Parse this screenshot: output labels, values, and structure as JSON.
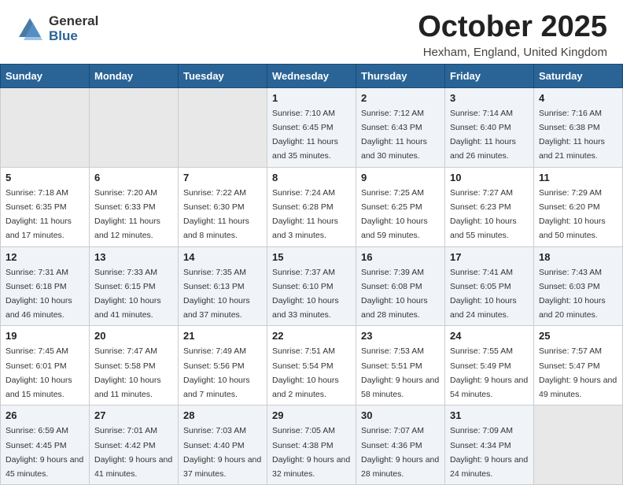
{
  "header": {
    "logo_general": "General",
    "logo_blue": "Blue",
    "month_title": "October 2025",
    "location": "Hexham, England, United Kingdom"
  },
  "days_of_week": [
    "Sunday",
    "Monday",
    "Tuesday",
    "Wednesday",
    "Thursday",
    "Friday",
    "Saturday"
  ],
  "weeks": [
    [
      {
        "day": "",
        "empty": true
      },
      {
        "day": "",
        "empty": true
      },
      {
        "day": "",
        "empty": true
      },
      {
        "day": "1",
        "sunrise": "7:10 AM",
        "sunset": "6:45 PM",
        "daylight": "11 hours and 35 minutes."
      },
      {
        "day": "2",
        "sunrise": "7:12 AM",
        "sunset": "6:43 PM",
        "daylight": "11 hours and 30 minutes."
      },
      {
        "day": "3",
        "sunrise": "7:14 AM",
        "sunset": "6:40 PM",
        "daylight": "11 hours and 26 minutes."
      },
      {
        "day": "4",
        "sunrise": "7:16 AM",
        "sunset": "6:38 PM",
        "daylight": "11 hours and 21 minutes."
      }
    ],
    [
      {
        "day": "5",
        "sunrise": "7:18 AM",
        "sunset": "6:35 PM",
        "daylight": "11 hours and 17 minutes."
      },
      {
        "day": "6",
        "sunrise": "7:20 AM",
        "sunset": "6:33 PM",
        "daylight": "11 hours and 12 minutes."
      },
      {
        "day": "7",
        "sunrise": "7:22 AM",
        "sunset": "6:30 PM",
        "daylight": "11 hours and 8 minutes."
      },
      {
        "day": "8",
        "sunrise": "7:24 AM",
        "sunset": "6:28 PM",
        "daylight": "11 hours and 3 minutes."
      },
      {
        "day": "9",
        "sunrise": "7:25 AM",
        "sunset": "6:25 PM",
        "daylight": "10 hours and 59 minutes."
      },
      {
        "day": "10",
        "sunrise": "7:27 AM",
        "sunset": "6:23 PM",
        "daylight": "10 hours and 55 minutes."
      },
      {
        "day": "11",
        "sunrise": "7:29 AM",
        "sunset": "6:20 PM",
        "daylight": "10 hours and 50 minutes."
      }
    ],
    [
      {
        "day": "12",
        "sunrise": "7:31 AM",
        "sunset": "6:18 PM",
        "daylight": "10 hours and 46 minutes."
      },
      {
        "day": "13",
        "sunrise": "7:33 AM",
        "sunset": "6:15 PM",
        "daylight": "10 hours and 41 minutes."
      },
      {
        "day": "14",
        "sunrise": "7:35 AM",
        "sunset": "6:13 PM",
        "daylight": "10 hours and 37 minutes."
      },
      {
        "day": "15",
        "sunrise": "7:37 AM",
        "sunset": "6:10 PM",
        "daylight": "10 hours and 33 minutes."
      },
      {
        "day": "16",
        "sunrise": "7:39 AM",
        "sunset": "6:08 PM",
        "daylight": "10 hours and 28 minutes."
      },
      {
        "day": "17",
        "sunrise": "7:41 AM",
        "sunset": "6:05 PM",
        "daylight": "10 hours and 24 minutes."
      },
      {
        "day": "18",
        "sunrise": "7:43 AM",
        "sunset": "6:03 PM",
        "daylight": "10 hours and 20 minutes."
      }
    ],
    [
      {
        "day": "19",
        "sunrise": "7:45 AM",
        "sunset": "6:01 PM",
        "daylight": "10 hours and 15 minutes."
      },
      {
        "day": "20",
        "sunrise": "7:47 AM",
        "sunset": "5:58 PM",
        "daylight": "10 hours and 11 minutes."
      },
      {
        "day": "21",
        "sunrise": "7:49 AM",
        "sunset": "5:56 PM",
        "daylight": "10 hours and 7 minutes."
      },
      {
        "day": "22",
        "sunrise": "7:51 AM",
        "sunset": "5:54 PM",
        "daylight": "10 hours and 2 minutes."
      },
      {
        "day": "23",
        "sunrise": "7:53 AM",
        "sunset": "5:51 PM",
        "daylight": "9 hours and 58 minutes."
      },
      {
        "day": "24",
        "sunrise": "7:55 AM",
        "sunset": "5:49 PM",
        "daylight": "9 hours and 54 minutes."
      },
      {
        "day": "25",
        "sunrise": "7:57 AM",
        "sunset": "5:47 PM",
        "daylight": "9 hours and 49 minutes."
      }
    ],
    [
      {
        "day": "26",
        "sunrise": "6:59 AM",
        "sunset": "4:45 PM",
        "daylight": "9 hours and 45 minutes."
      },
      {
        "day": "27",
        "sunrise": "7:01 AM",
        "sunset": "4:42 PM",
        "daylight": "9 hours and 41 minutes."
      },
      {
        "day": "28",
        "sunrise": "7:03 AM",
        "sunset": "4:40 PM",
        "daylight": "9 hours and 37 minutes."
      },
      {
        "day": "29",
        "sunrise": "7:05 AM",
        "sunset": "4:38 PM",
        "daylight": "9 hours and 32 minutes."
      },
      {
        "day": "30",
        "sunrise": "7:07 AM",
        "sunset": "4:36 PM",
        "daylight": "9 hours and 28 minutes."
      },
      {
        "day": "31",
        "sunrise": "7:09 AM",
        "sunset": "4:34 PM",
        "daylight": "9 hours and 24 minutes."
      },
      {
        "day": "",
        "empty": true
      }
    ]
  ],
  "labels": {
    "sunrise": "Sunrise:",
    "sunset": "Sunset:",
    "daylight": "Daylight:"
  }
}
